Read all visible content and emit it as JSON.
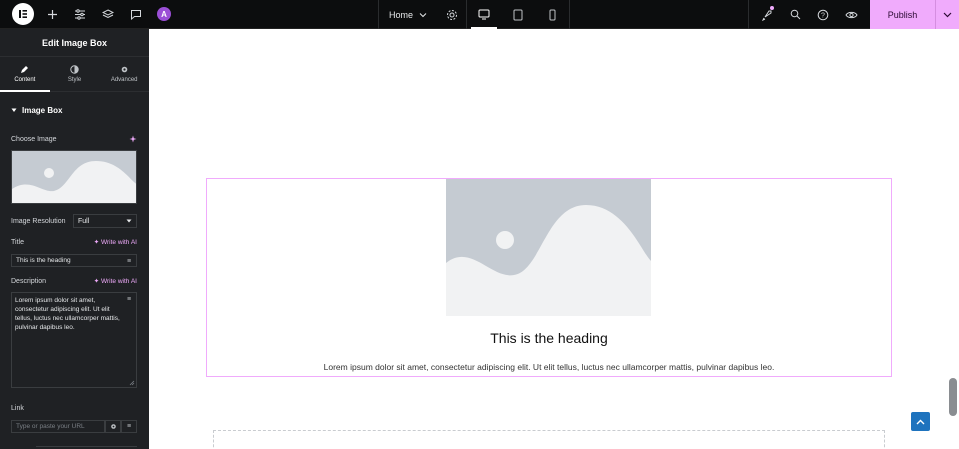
{
  "topbar": {
    "page_name": "Home",
    "publish_label": "Publish"
  },
  "panel": {
    "title": "Edit Image Box",
    "tabs": [
      {
        "label": "Content"
      },
      {
        "label": "Style"
      },
      {
        "label": "Advanced"
      }
    ],
    "section": "Image Box",
    "choose_image_label": "Choose Image",
    "image_resolution_label": "Image Resolution",
    "image_resolution_value": "Full",
    "title_label": "Title",
    "write_with_ai": "Write with AI",
    "title_value": "This is the heading",
    "description_label": "Description",
    "description_value": "Lorem ipsum dolor sit amet, consectetur adipiscing elit. Ut elit tellus, luctus nec ullamcorper mattis, pulvinar dapibus leo.",
    "link_label": "Link",
    "link_placeholder": "Type or paste your URL"
  },
  "canvas": {
    "heading": "This is the heading",
    "description": "Lorem ipsum dolor sit amet, consectetur adipiscing elit. Ut elit tellus, luctus nec ullamcorper mattis, pulvinar dapibus leo."
  },
  "colors": {
    "accent": "#f0abfc",
    "panel_bg": "#1f2124",
    "topbar_bg": "#0c0d0e",
    "placeholder_image": "#c5cbd2"
  }
}
